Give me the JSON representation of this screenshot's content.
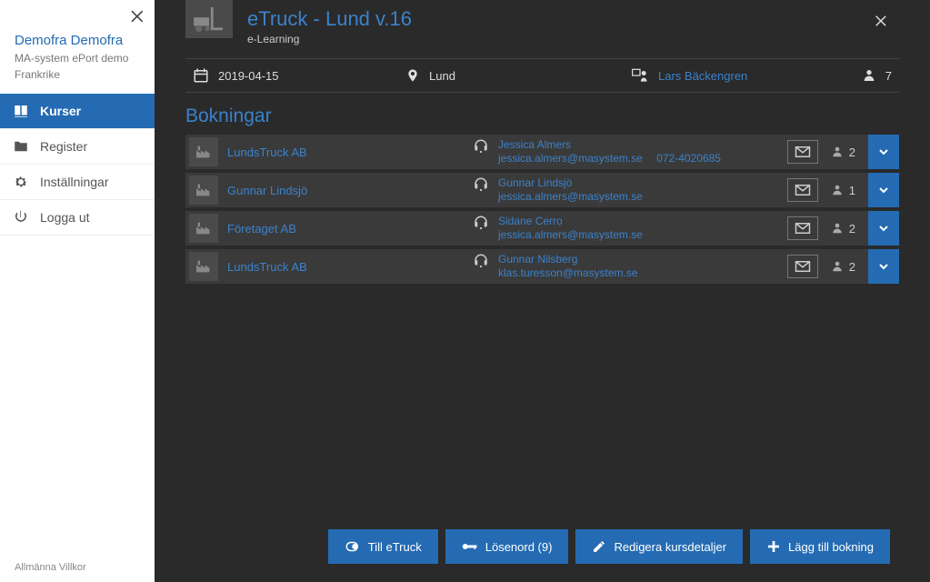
{
  "sidebar": {
    "user_name": "Demofra Demofra",
    "org": "MA-system ePort demo",
    "country": "Frankrike",
    "nav": [
      {
        "label": "Kurser"
      },
      {
        "label": "Register"
      },
      {
        "label": "Inställningar"
      },
      {
        "label": "Logga ut"
      }
    ],
    "footer": "Allmänna Villkor"
  },
  "header": {
    "title": "eTruck - Lund v.16",
    "subtitle": "e-Learning"
  },
  "infobar": {
    "date": "2019-04-15",
    "location": "Lund",
    "instructor": "Lars Bäckengren",
    "total_count": "7"
  },
  "section_title": "Bokningar",
  "bookings": [
    {
      "company": "LundsTruck AB",
      "contact_name": "Jessica Almers",
      "contact_email": "jessica.almers@masystem.se",
      "contact_phone": "072-4020685",
      "count": "2"
    },
    {
      "company": "Gunnar Lindsjö",
      "contact_name": "Gunnar Lindsjö",
      "contact_email": "jessica.almers@masystem.se",
      "contact_phone": "",
      "count": "1"
    },
    {
      "company": "Företaget AB",
      "contact_name": "Sidane Cerro",
      "contact_email": "jessica.almers@masystem.se",
      "contact_phone": "",
      "count": "2"
    },
    {
      "company": "LundsTruck AB",
      "contact_name": "Gunnar Nilsberg",
      "contact_email": "klas.turesson@masystem.se",
      "contact_phone": "",
      "count": "2"
    }
  ],
  "buttons": {
    "to_etruck": "Till eTruck",
    "password": "Lösenord (9)",
    "edit": "Redigera kursdetaljer",
    "add": "Lägg till bokning"
  }
}
